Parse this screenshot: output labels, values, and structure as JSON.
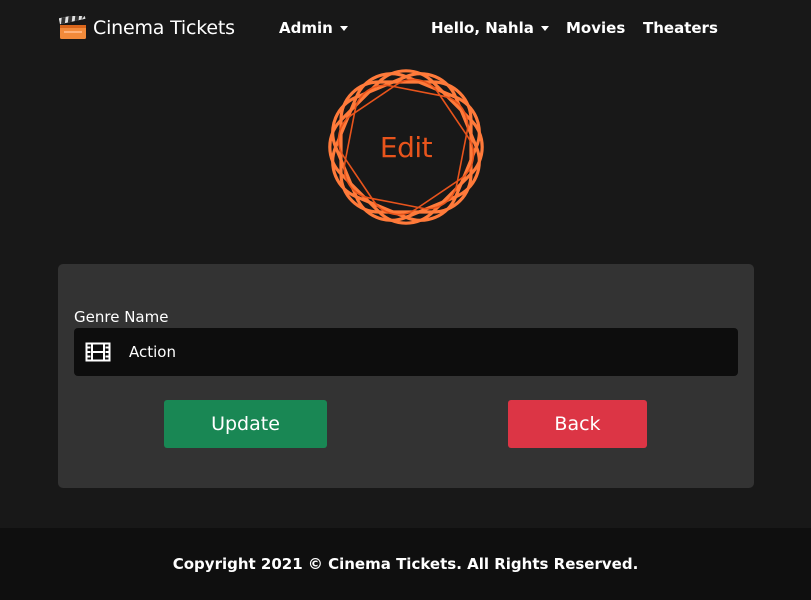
{
  "navbar": {
    "brand": "Cinema Tickets",
    "brand_icon": "clapperboard-icon",
    "admin_label": "Admin",
    "user_label": "Hello, Nahla",
    "movies_label": "Movies",
    "theaters_label": "Theaters"
  },
  "emblem": {
    "text": "Edit",
    "color": "#e8541c"
  },
  "form": {
    "genre_label": "Genre Name",
    "genre_icon": "film-icon",
    "genre_value": "Action",
    "update_label": "Update",
    "back_label": "Back"
  },
  "colors": {
    "update": "#198754",
    "back": "#dc3545",
    "accent": "#ff7a3a"
  },
  "footer": {
    "text": "Copyright 2021 © Cinema Tickets. All Rights Reserved."
  }
}
